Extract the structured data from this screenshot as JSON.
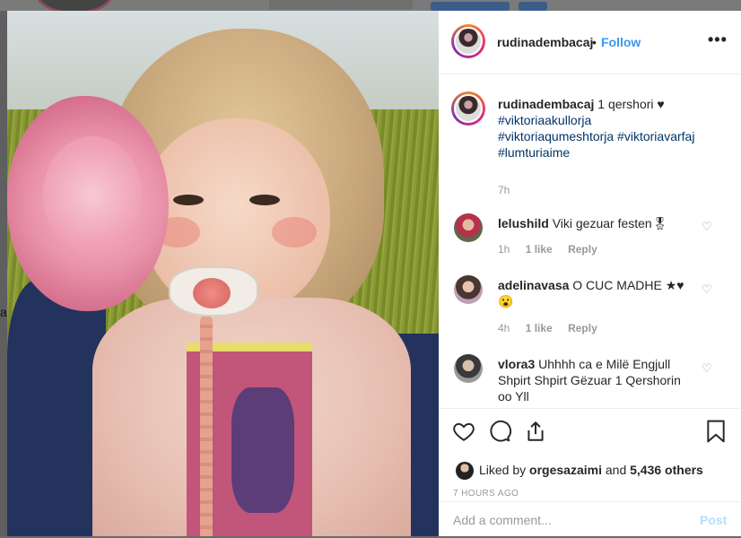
{
  "header": {
    "username": "rudinadembacaj",
    "separator": "•",
    "follow_label": "Follow",
    "more_label": "•••"
  },
  "caption": {
    "username": "rudinadembacaj",
    "text": "1 qershori ♥",
    "hashtags": [
      "#viktoriaakullorja",
      "#viktoriaqumeshtorja #viktoriavarfaj",
      "#lumturiaime"
    ],
    "time": "7h"
  },
  "comments": [
    {
      "username": "lelushild",
      "text": "Viki gezuar festen🎖",
      "time": "1h",
      "likes": "1 like",
      "reply": "Reply"
    },
    {
      "username": "adelinavasa",
      "text": "O CUC MADHE ★♥ 😮",
      "time": "4h",
      "likes": "1 like",
      "reply": "Reply"
    },
    {
      "username": "vlora3",
      "text": "Uhhhh ca e Milë Engjull Shpirt Shpirt Gëzuar 1 Qershorin oo Yll",
      "time": "",
      "likes": "",
      "reply": ""
    }
  ],
  "actions": {
    "like_icon": "heart-icon",
    "comment_icon": "comment-icon",
    "share_icon": "share-icon",
    "save_icon": "bookmark-icon"
  },
  "likes": {
    "prefix": "Liked by",
    "user": "orgesazaimi",
    "and": "and",
    "others": "5,436 others"
  },
  "posted_ago": "7 HOURS AGO",
  "add_comment": {
    "placeholder": "Add a comment...",
    "post_label": "Post"
  },
  "colors": {
    "link": "#3897f0",
    "hashtag": "#003569",
    "muted": "#999999",
    "post_disabled": "#b2dffc"
  }
}
